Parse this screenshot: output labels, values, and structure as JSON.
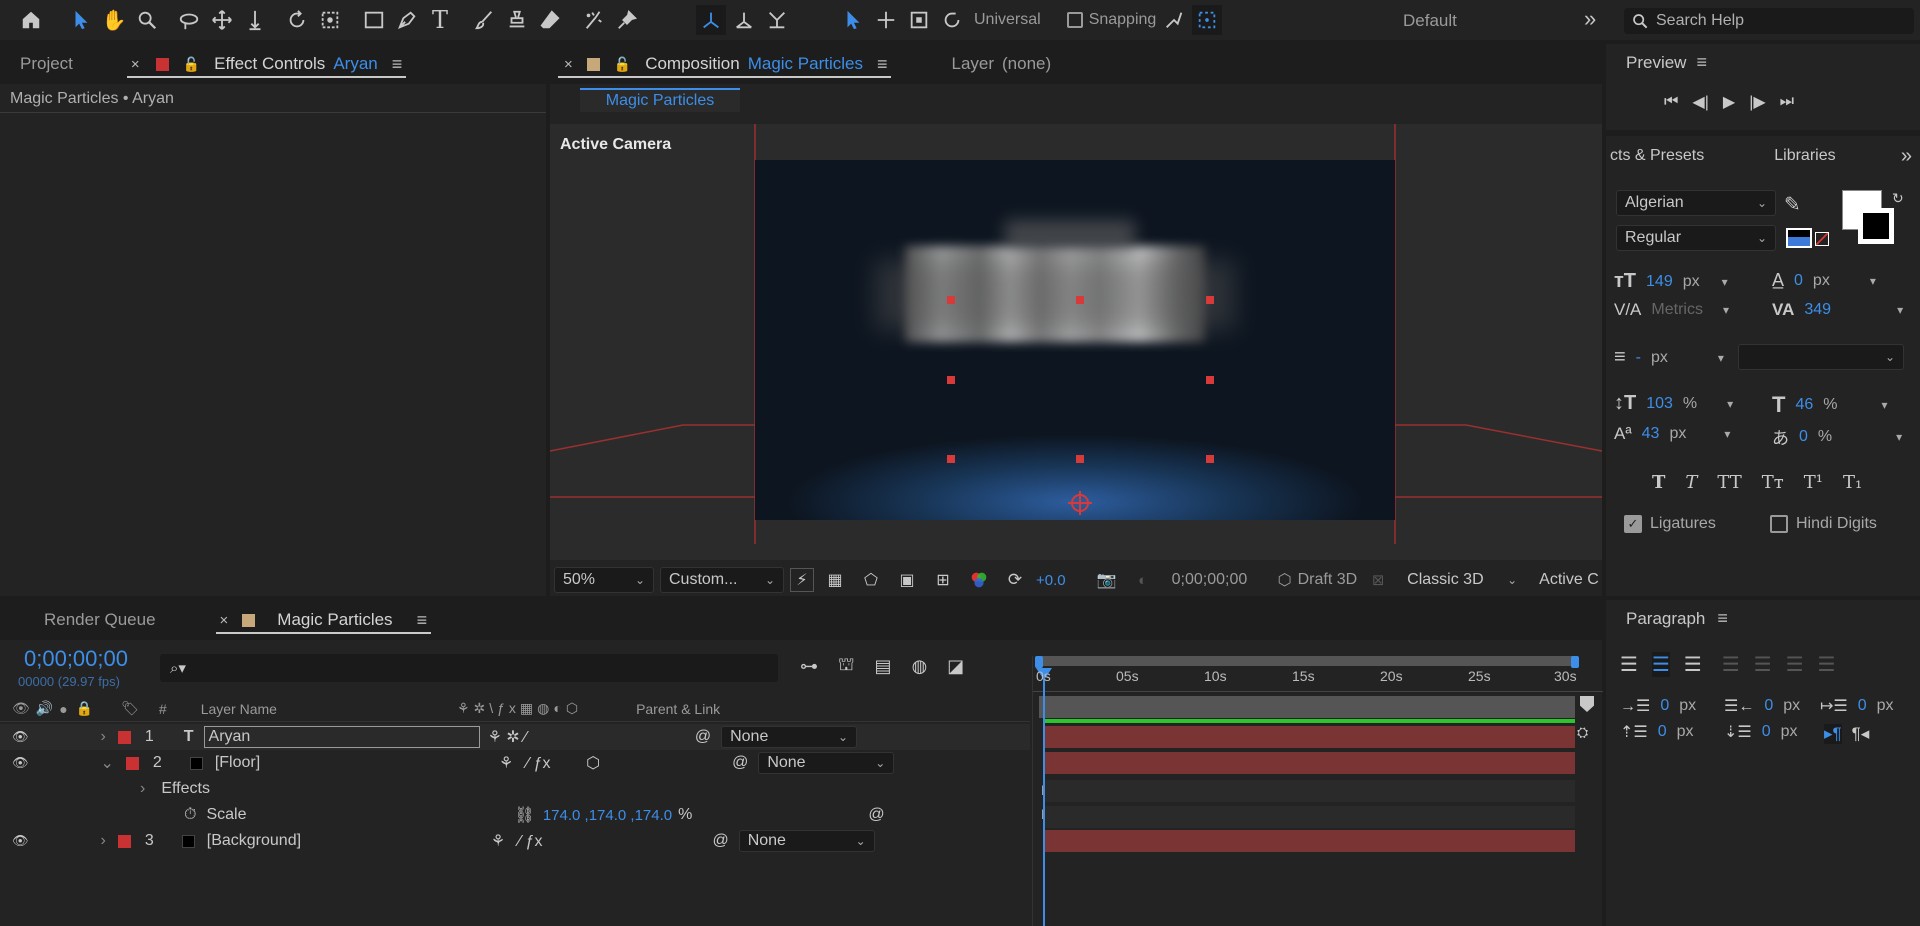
{
  "toolbar": {
    "universal": "Universal",
    "snapping": "Snapping",
    "workspace": "Default",
    "search_placeholder": "Search Help"
  },
  "left_panel": {
    "tab_project": "Project",
    "tab_effect_controls": "Effect Controls",
    "effect_layer": "Aryan",
    "breadcrumb": "Magic Particles • Aryan"
  },
  "comp_panel": {
    "tab_label": "Composition",
    "comp_name": "Magic Particles",
    "layer_tab": "Layer",
    "layer_value": "(none)",
    "subtab": "Magic Particles",
    "camera_label": "Active Camera",
    "zoom": "50%",
    "resolution": "Custom...",
    "exposure": "+0.0",
    "timecode": "0;00;00;00",
    "renderer": "Draft 3D",
    "renderer_mode": "Classic 3D",
    "view": "Active C"
  },
  "right_panel": {
    "preview_tab": "Preview",
    "effects_tab": "cts & Presets",
    "libraries_tab": "Libraries",
    "font_family": "Algerian",
    "font_style": "Regular",
    "font_size": "149",
    "font_size_unit": "px",
    "leading": "0",
    "leading_unit": "px",
    "kerning": "Metrics",
    "tracking": "349",
    "stroke": "-",
    "stroke_unit": "px",
    "vscale": "103",
    "vscale_unit": "%",
    "hscale": "46",
    "hscale_unit": "%",
    "baseline": "43",
    "baseline_unit": "px",
    "tsume": "0",
    "tsume_unit": "%",
    "ligatures": "Ligatures",
    "hindi_digits": "Hindi Digits",
    "text_styles": [
      "T",
      "T",
      "TT",
      "Tт",
      "T¹",
      "T₁"
    ],
    "fill_color": "#ffffff",
    "stroke_color": "#000000"
  },
  "paragraph_panel": {
    "tab": "Paragraph",
    "indent_left": "0",
    "indent_right": "0",
    "indent_first": "0",
    "space_before": "0",
    "space_after": "0",
    "unit": "px"
  },
  "timeline": {
    "tab_render_queue": "Render Queue",
    "tab_comp": "Magic Particles",
    "timecode": "0;00;00;00",
    "frames": "00000 (29.97 fps)",
    "search_placeholder": "",
    "col_number": "#",
    "col_layer_name": "Layer Name",
    "col_parent": "Parent & Link",
    "ruler": [
      "0s",
      "05s",
      "10s",
      "15s",
      "20s",
      "25s",
      "30s"
    ],
    "layers": [
      {
        "num": "1",
        "name": "Aryan",
        "parent": "None",
        "color": "#c83232",
        "type": "T"
      },
      {
        "num": "2",
        "name": "[Floor]",
        "parent": "None",
        "color": "#c83232",
        "type": "solid"
      },
      {
        "num": "3",
        "name": "[Background]",
        "parent": "None",
        "color": "#c83232",
        "type": "solid"
      }
    ],
    "effects_label": "Effects",
    "scale_label": "Scale",
    "scale_value": "174.0 ,174.0 ,174.0",
    "scale_unit": "%"
  },
  "colors": {
    "accent": "#3d8ee8",
    "layer_bar": "#7a3434",
    "work_area": "#2ec42e"
  }
}
